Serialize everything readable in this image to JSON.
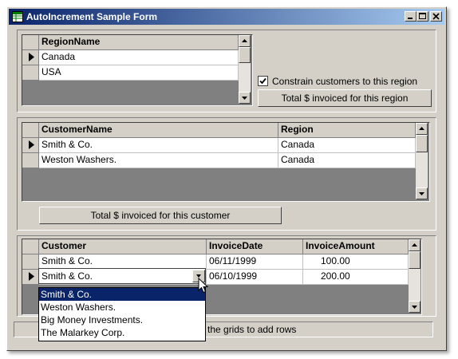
{
  "window": {
    "title": "AutoIncrement Sample Form"
  },
  "region_grid": {
    "header": "RegionName",
    "rows": [
      "Canada",
      "USA"
    ]
  },
  "constrain_checkbox": {
    "label": "Constrain customers to this region",
    "checked": true
  },
  "region_total_button": "Total $ invoiced for this region",
  "customer_grid": {
    "headers": [
      "CustomerName",
      "Region"
    ],
    "rows": [
      [
        "Smith & Co.",
        "Canada"
      ],
      [
        "Weston Washers.",
        "Canada"
      ]
    ]
  },
  "customer_total_button": "Total $ invoiced for this customer",
  "invoice_grid": {
    "headers": [
      "Customer",
      "InvoiceDate",
      "InvoiceAmount"
    ],
    "rows": [
      [
        "Smith & Co.",
        "06/11/1999",
        "100.00"
      ],
      [
        "Smith & Co.",
        "06/10/1999",
        "200.00"
      ]
    ]
  },
  "customer_dropdown": {
    "options": [
      "Smith & Co.",
      "Weston Washers.",
      "Big Money Investments.",
      "The Malarkey Corp."
    ]
  },
  "status_bar": {
    "visible_text": "the grids to add rows"
  }
}
